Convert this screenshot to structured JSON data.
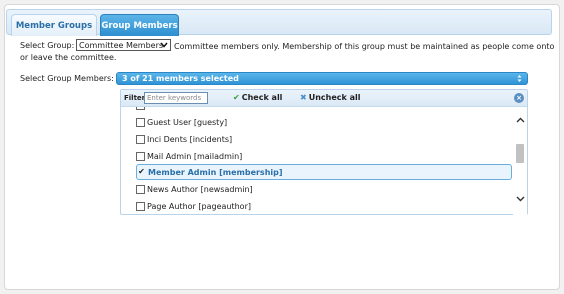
{
  "tabs": [
    {
      "label": "Member Groups",
      "active": false
    },
    {
      "label": "Group Members",
      "active": true
    }
  ],
  "select_group": {
    "label": "Select Group:",
    "value": "Committee Members",
    "description": "Committee members only. Membership of this group must be maintained as people come onto or leave the committee."
  },
  "select_members": {
    "label": "Select Group Members:",
    "button_text": "3 of 21 members selected"
  },
  "dropdown": {
    "filter_label": "Filter:",
    "filter_placeholder": "Enter keywords",
    "filter_value": "",
    "check_all": "Check all",
    "uncheck_all": "Uncheck all",
    "close_icon": "close-circle-icon",
    "items": [
      {
        "label": "Guest User [guesty]",
        "checked": false,
        "selected": false
      },
      {
        "label": "Inci Dents [incidents]",
        "checked": false,
        "selected": false
      },
      {
        "label": "Mail Admin [mailadmin]",
        "checked": false,
        "selected": false
      },
      {
        "label": "Member Admin [membership]",
        "checked": true,
        "selected": true
      },
      {
        "label": "News Author [newsadmin]",
        "checked": false,
        "selected": false
      },
      {
        "label": "Page Author [pageauthor]",
        "checked": false,
        "selected": false
      }
    ]
  },
  "colors": {
    "accent": "#2f93d6",
    "tab_active_bg": "#3c9ee0",
    "tab_text": "#2a6fa8",
    "selected_row_bg": "#eaf4fd"
  }
}
